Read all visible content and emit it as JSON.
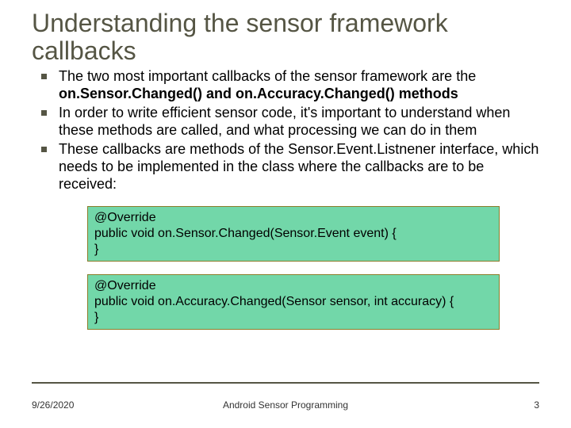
{
  "title": "Understanding the sensor framework callbacks",
  "bullets": [
    {
      "pre": "The two most important callbacks of the sensor framework are the ",
      "bold": "on.Sensor.Changed() and on.Accuracy.Changed() methods",
      "post": ""
    },
    {
      "pre": "In order to write efficient sensor code, it's important to understand when these methods are called, and what processing we can do in them",
      "bold": "",
      "post": ""
    },
    {
      "pre": "These callbacks are methods of the Sensor.Event.Listnener interface, which needs to be implemented in the class where the callbacks are to be received:",
      "bold": "",
      "post": ""
    }
  ],
  "code_blocks": [
    "@Override\npublic void on.Sensor.Changed(Sensor.Event event) {\n}",
    "@Override\npublic void on.Accuracy.Changed(Sensor sensor, int accuracy) {\n}"
  ],
  "footer": {
    "date": "9/26/2020",
    "center": "Android Sensor Programming",
    "page": "3"
  }
}
